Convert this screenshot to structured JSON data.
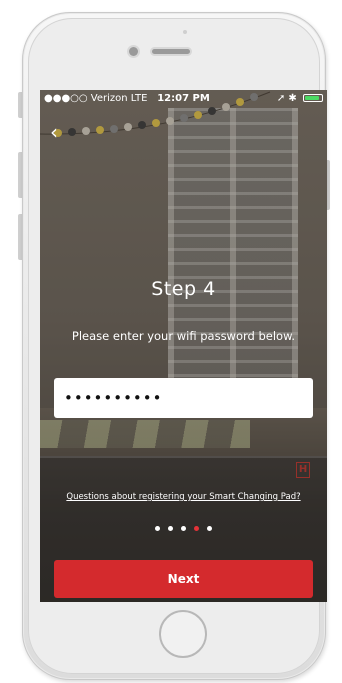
{
  "status_bar": {
    "carrier": "●●●○○ Verizon  LTE",
    "time": "12:07 PM",
    "indicators": "➚ ✱"
  },
  "icons": {
    "back": "‹",
    "battery": "battery-icon",
    "location": "location-arrow-icon",
    "bluetooth": "bluetooth-icon"
  },
  "battery_level": 0.85,
  "brand_mark": "H",
  "step": {
    "title": "Step 4",
    "instructions": "Please enter your wifi password below."
  },
  "password_field": {
    "value": "••••••••••"
  },
  "help_link": "Questions about registering your Smart Changing Pad?",
  "pager": {
    "count": 5,
    "active_index": 3
  },
  "next_button": "Next",
  "colors": {
    "accent_red": "#d42a2d",
    "active_dot": "#e53238",
    "battery_green": "#4cd964"
  }
}
